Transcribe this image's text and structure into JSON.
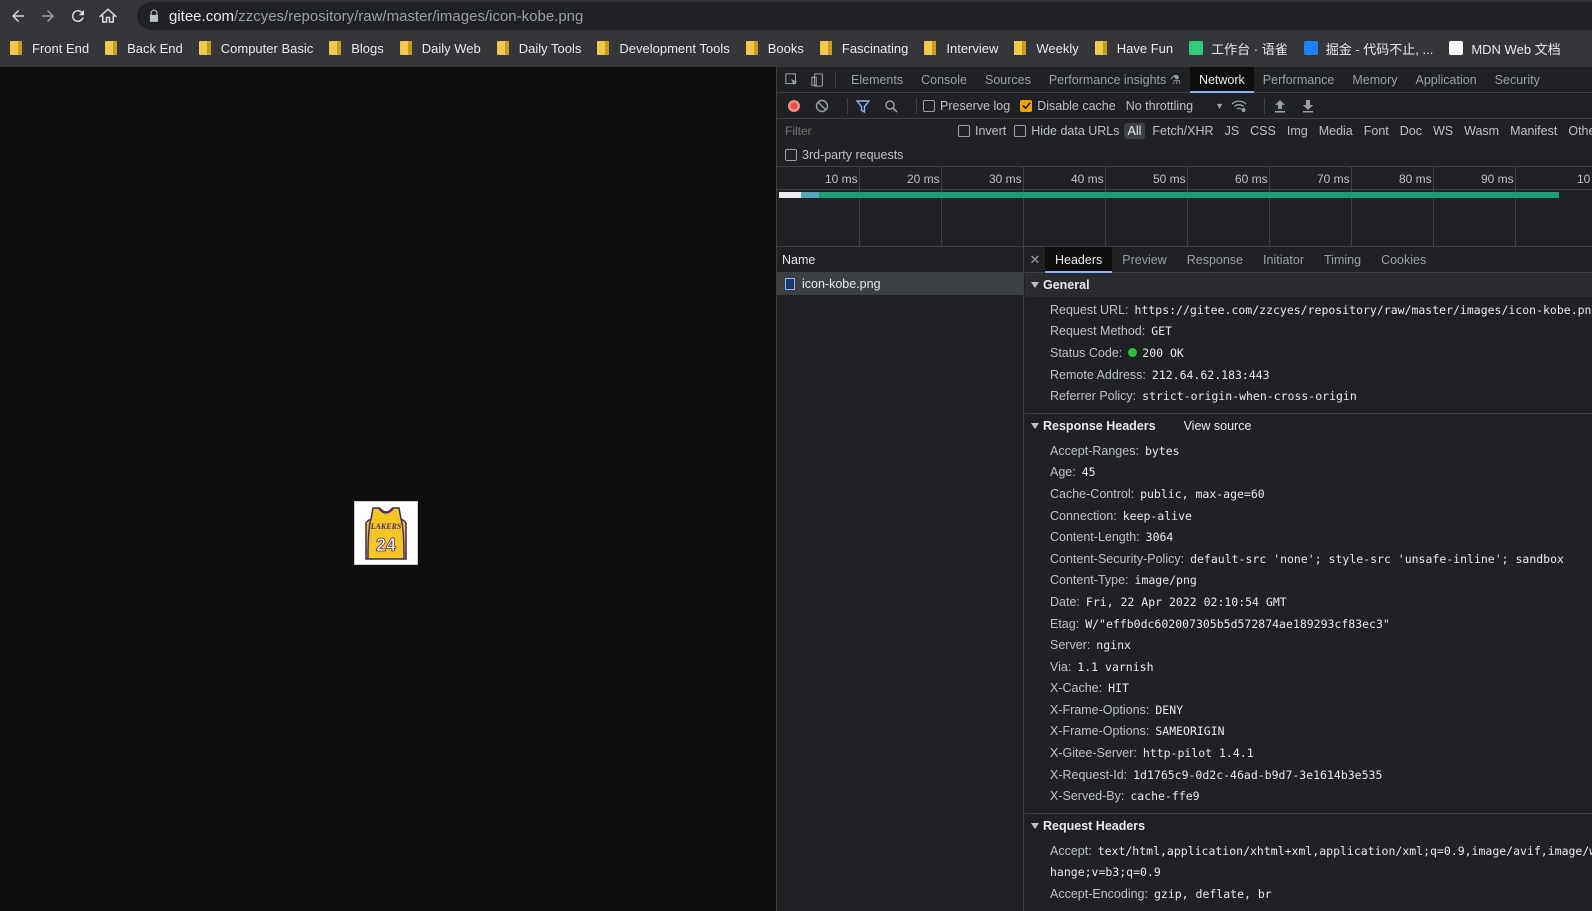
{
  "browser": {
    "url_host": "gitee.com",
    "url_path": "/zzcyes/repository/raw/master/images/icon-kobe.png",
    "bookmarks": [
      {
        "label": "Front End",
        "icon": "folder-icon"
      },
      {
        "label": "Back End",
        "icon": "folder-icon"
      },
      {
        "label": "Computer Basic",
        "icon": "folder-icon"
      },
      {
        "label": "Blogs",
        "icon": "folder-icon"
      },
      {
        "label": "Daily Web",
        "icon": "folder-icon"
      },
      {
        "label": "Daily Tools",
        "icon": "folder-icon"
      },
      {
        "label": "Development Tools",
        "icon": "folder-icon"
      },
      {
        "label": "Books",
        "icon": "folder-icon"
      },
      {
        "label": "Fascinating",
        "icon": "folder-icon"
      },
      {
        "label": "Interview",
        "icon": "folder-icon"
      },
      {
        "label": "Weekly",
        "icon": "folder-icon"
      },
      {
        "label": "Have Fun",
        "icon": "folder-icon"
      },
      {
        "label": "工作台 · 语雀",
        "icon": "yuque-icon"
      },
      {
        "label": "掘金 - 代码不止, ...",
        "icon": "juejin-icon"
      },
      {
        "label": "MDN Web 文档",
        "icon": "mdn-icon"
      }
    ]
  },
  "page": {
    "image_alt": "icon-kobe.png",
    "jersey_text": "LAKERS",
    "jersey_number": "24"
  },
  "devtools": {
    "tabs": [
      "Elements",
      "Console",
      "Sources",
      "Performance insights",
      "Network",
      "Performance",
      "Memory",
      "Application",
      "Security"
    ],
    "active_tab": "Network",
    "toolbar": {
      "preserve_log": "Preserve log",
      "disable_cache": "Disable cache",
      "throttling": "No throttling"
    },
    "filter": {
      "placeholder": "Filter",
      "invert": "Invert",
      "hide_data_urls": "Hide data URLs",
      "types": [
        "All",
        "Fetch/XHR",
        "JS",
        "CSS",
        "Img",
        "Media",
        "Font",
        "Doc",
        "WS",
        "Wasm",
        "Manifest",
        "Other"
      ],
      "third_party": "3rd-party requests"
    },
    "timeline_ticks": [
      "10 ms",
      "20 ms",
      "30 ms",
      "40 ms",
      "50 ms",
      "60 ms",
      "70 ms",
      "80 ms",
      "90 ms",
      "10"
    ],
    "name_header": "Name",
    "request_name": "icon-kobe.png",
    "detail_tabs": [
      "Headers",
      "Preview",
      "Response",
      "Initiator",
      "Timing",
      "Cookies"
    ],
    "general": {
      "title": "General",
      "rows": [
        {
          "k": "Request URL:",
          "v": "https://gitee.com/zzcyes/repository/raw/master/images/icon-kobe.png"
        },
        {
          "k": "Request Method:",
          "v": "GET"
        },
        {
          "k": "Status Code:",
          "v": "200 OK"
        },
        {
          "k": "Remote Address:",
          "v": "212.64.62.183:443"
        },
        {
          "k": "Referrer Policy:",
          "v": "strict-origin-when-cross-origin"
        }
      ]
    },
    "response_headers": {
      "title": "Response Headers",
      "view_source": "View source",
      "rows": [
        {
          "k": "Accept-Ranges:",
          "v": "bytes"
        },
        {
          "k": "Age:",
          "v": "45"
        },
        {
          "k": "Cache-Control:",
          "v": "public, max-age=60"
        },
        {
          "k": "Connection:",
          "v": "keep-alive"
        },
        {
          "k": "Content-Length:",
          "v": "3064"
        },
        {
          "k": "Content-Security-Policy:",
          "v": "default-src 'none'; style-src 'unsafe-inline'; sandbox"
        },
        {
          "k": "Content-Type:",
          "v": "image/png"
        },
        {
          "k": "Date:",
          "v": "Fri, 22 Apr 2022 02:10:54 GMT"
        },
        {
          "k": "Etag:",
          "v": "W/\"effb0dc602007305b5d572874ae189293cf83ec3\""
        },
        {
          "k": "Server:",
          "v": "nginx"
        },
        {
          "k": "Via:",
          "v": "1.1 varnish"
        },
        {
          "k": "X-Cache:",
          "v": "HIT"
        },
        {
          "k": "X-Frame-Options:",
          "v": "DENY"
        },
        {
          "k": "X-Frame-Options:",
          "v": "SAMEORIGIN"
        },
        {
          "k": "X-Gitee-Server:",
          "v": "http-pilot 1.4.1"
        },
        {
          "k": "X-Request-Id:",
          "v": "1d1765c9-0d2c-46ad-b9d7-3e1614b3e535"
        },
        {
          "k": "X-Served-By:",
          "v": "cache-ffe9"
        }
      ]
    },
    "request_headers": {
      "title": "Request Headers",
      "rows": [
        {
          "k": "Accept:",
          "v": "text/html,application/xhtml+xml,application/xml;q=0.9,image/avif,image/we"
        },
        {
          "k": "",
          "v": "hange;v=b3;q=0.9"
        },
        {
          "k": "Accept-Encoding:",
          "v": "gzip, deflate, br"
        }
      ]
    },
    "colors": {
      "status_ok": "#2fbf3a",
      "active_tab_underline": "#8ab4f8",
      "checkbox_on": "#f0a000",
      "timeline_bar": "#1d9e74"
    }
  }
}
